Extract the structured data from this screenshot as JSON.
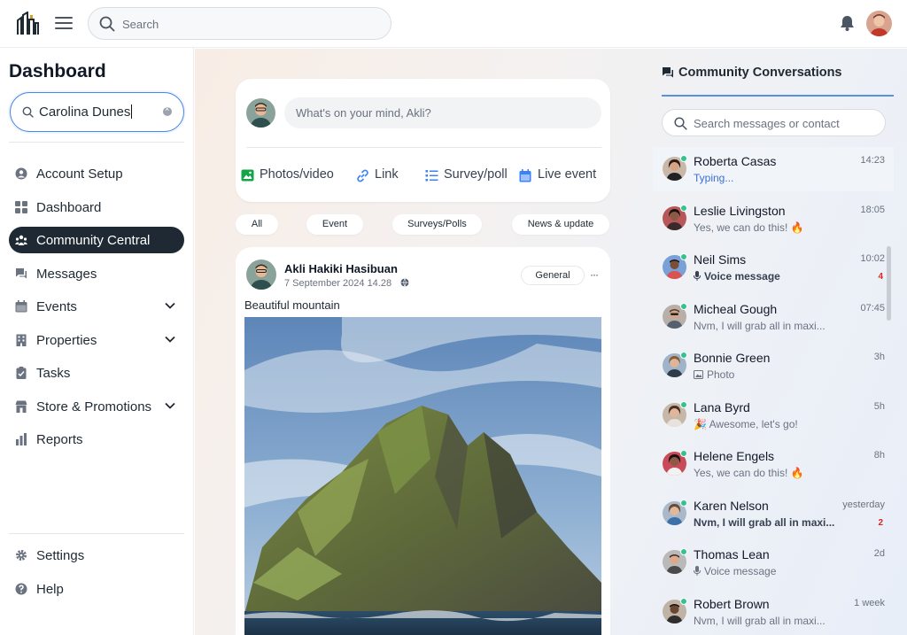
{
  "topbar": {
    "search_placeholder": "Search"
  },
  "sidebar": {
    "title": "Dashboard",
    "search_value": "Carolina Dunes",
    "items": [
      {
        "label": "Account Setup",
        "icon": "user-circle-icon"
      },
      {
        "label": "Dashboard",
        "icon": "grid-icon"
      },
      {
        "label": "Community Central",
        "icon": "users-icon",
        "active": true
      },
      {
        "label": "Messages",
        "icon": "chat-icon"
      },
      {
        "label": "Events",
        "icon": "calendar-icon",
        "expandable": true
      },
      {
        "label": "Properties",
        "icon": "building-icon",
        "expandable": true
      },
      {
        "label": "Tasks",
        "icon": "clipboard-icon"
      },
      {
        "label": "Store & Promotions",
        "icon": "store-icon",
        "expandable": true
      },
      {
        "label": "Reports",
        "icon": "chart-icon"
      }
    ],
    "footer": [
      {
        "label": "Settings",
        "icon": "gear-icon"
      },
      {
        "label": "Help",
        "icon": "help-icon"
      }
    ]
  },
  "composer": {
    "placeholder": "What's on your mind, Akli?",
    "actions": [
      {
        "label": "Photos/video",
        "icon": "image-icon",
        "color": "#16a34a"
      },
      {
        "label": "Link",
        "icon": "link-icon",
        "color": "#3b82f6"
      },
      {
        "label": "Survey/poll",
        "icon": "list-icon",
        "color": "#3b82f6"
      },
      {
        "label": "Live event",
        "icon": "calendar-icon",
        "color": "#3b82f6"
      }
    ]
  },
  "filters": [
    "All",
    "Event",
    "Surveys/Polls",
    "News & update"
  ],
  "post": {
    "author": "Akli Hakiki Hasibuan",
    "date": "7 September 2024  14.28",
    "tag": "General",
    "more": "···",
    "caption": "Beautiful mountain"
  },
  "conversations": {
    "title": "Community Conversations",
    "search_placeholder": "Search messages or contact",
    "items": [
      {
        "name": "Roberta Casas",
        "preview": "Typing...",
        "time": "14:23",
        "style": "typing",
        "selected": true
      },
      {
        "name": "Leslie Livingston",
        "preview": "Yes, we can do this! 🔥",
        "time": "18:05"
      },
      {
        "name": "Neil Sims",
        "preview": "Voice message",
        "time": "10:02",
        "badge": "4",
        "style": "voice-bold"
      },
      {
        "name": "Micheal Gough",
        "preview": "Nvm, I will grab all in maxi...",
        "time": "07:45"
      },
      {
        "name": "Bonnie Green",
        "preview": "Photo",
        "time": "3h",
        "style": "photo"
      },
      {
        "name": "Lana Byrd",
        "preview": "🎉 Awesome, let's go!",
        "time": "5h"
      },
      {
        "name": "Helene Engels",
        "preview": "Yes, we can do this! 🔥",
        "time": "8h"
      },
      {
        "name": "Karen Nelson",
        "preview": "Nvm, I will grab all in maxi...",
        "time": "yesterday",
        "badge": "2",
        "style": "bold"
      },
      {
        "name": "Thomas Lean",
        "preview": "Voice message",
        "time": "2d",
        "style": "voice"
      },
      {
        "name": "Robert Brown",
        "preview": "Nvm, I will grab all in maxi...",
        "time": "1 week"
      }
    ]
  },
  "colors": {
    "accent": "#1e2933",
    "link_blue": "#3b6fd8",
    "online": "#31c48d",
    "unread": "#e02424"
  }
}
